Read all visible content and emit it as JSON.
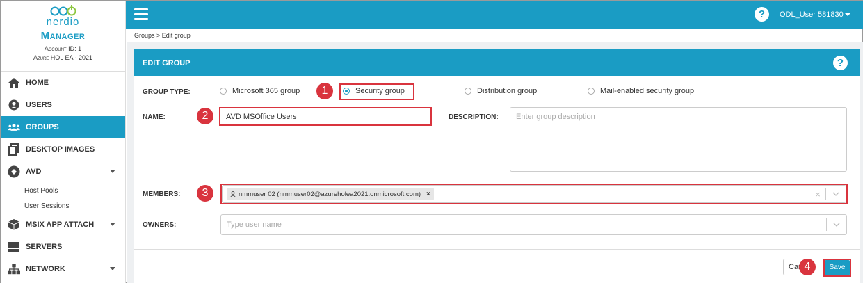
{
  "brand": {
    "logo_text": "nerdio",
    "product": "Manager",
    "account": "Account ID: 1",
    "environment": "Azure HOL EA - 2021"
  },
  "sidebar": {
    "items": [
      {
        "label": "HOME",
        "icon": "home-icon"
      },
      {
        "label": "USERS",
        "icon": "user-icon"
      },
      {
        "label": "GROUPS",
        "icon": "users-icon",
        "active": true
      },
      {
        "label": "DESKTOP IMAGES",
        "icon": "copy-icon"
      },
      {
        "label": "AVD",
        "icon": "avd-icon"
      },
      {
        "label": "MSIX APP ATTACH",
        "icon": "box-icon"
      },
      {
        "label": "SERVERS",
        "icon": "server-icon"
      },
      {
        "label": "NETWORK",
        "icon": "network-icon"
      }
    ],
    "avd_sub": [
      "Host Pools",
      "User Sessions"
    ]
  },
  "topbar": {
    "help": "?",
    "user": "ODL_User 581830"
  },
  "breadcrumb": "Groups > Edit group",
  "card": {
    "title": "EDIT GROUP",
    "help": "?",
    "group_type_label": "GROUP TYPE:",
    "group_types": [
      "Microsoft 365 group",
      "Security group",
      "Distribution group",
      "Mail-enabled security group"
    ],
    "selected_group_type": "Security group",
    "name_label": "NAME:",
    "name_value": "AVD MSOffice Users",
    "description_label": "DESCRIPTION:",
    "description_placeholder": "Enter group description",
    "members_label": "MEMBERS:",
    "members": [
      "nmmuser 02 (nmmuser02@azureholea2021.onmicrosoft.com)"
    ],
    "owners_label": "OWNERS:",
    "owners_placeholder": "Type user name",
    "cancel_label": "Cancel",
    "save_label": "Save"
  },
  "callouts": [
    "1",
    "2",
    "3",
    "4"
  ],
  "colors": {
    "accent": "#1a9cc4",
    "highlight": "#d9343e"
  }
}
